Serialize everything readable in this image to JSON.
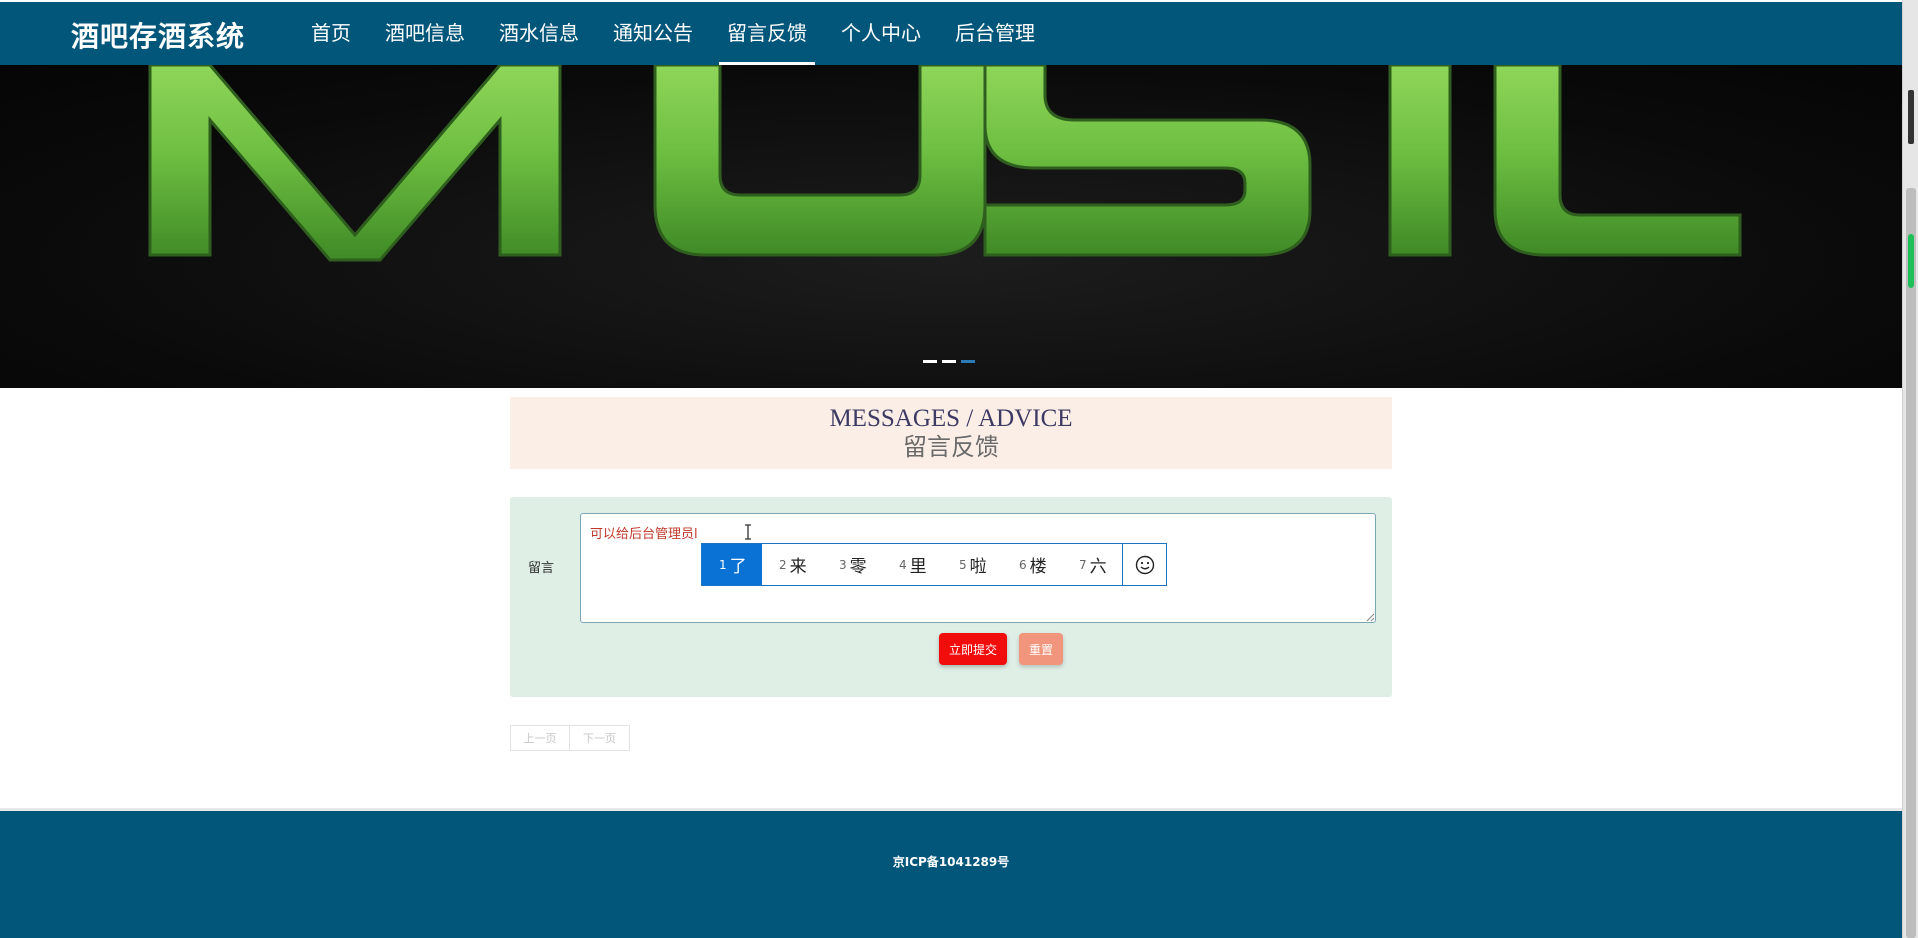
{
  "brand": "酒吧存酒系统",
  "nav": {
    "items": [
      "首页",
      "酒吧信息",
      "酒水信息",
      "通知公告",
      "留言反馈",
      "个人中心",
      "后台管理"
    ],
    "active": "留言反馈"
  },
  "banner": {
    "text": "MUSIC",
    "slides": 3,
    "active_slide": 3,
    "accent": "#7ad148"
  },
  "section": {
    "title_en": "MESSAGES / ADVICE",
    "title_cn": "留言反馈"
  },
  "form": {
    "label": "留言",
    "textarea_value": "可以给后台管理员l",
    "submit_label": "立即提交",
    "reset_label": "重置"
  },
  "ime": {
    "candidates": [
      {
        "num": "1",
        "text": "了"
      },
      {
        "num": "2",
        "text": "来"
      },
      {
        "num": "3",
        "text": "零"
      },
      {
        "num": "4",
        "text": "里"
      },
      {
        "num": "5",
        "text": "啦"
      },
      {
        "num": "6",
        "text": "楼"
      },
      {
        "num": "7",
        "text": "六"
      }
    ],
    "selected": 0,
    "extra_icon": "smiley-icon"
  },
  "pager": {
    "prev": "上一页",
    "next": "下一页"
  },
  "footer": {
    "icp": "京ICP备1041289号"
  },
  "colors": {
    "nav_bg": "#02567a",
    "submit": "#f20d0d",
    "reset": "#f2957d",
    "form_bg": "#dfefe6",
    "title_bg": "#fbeee6"
  }
}
